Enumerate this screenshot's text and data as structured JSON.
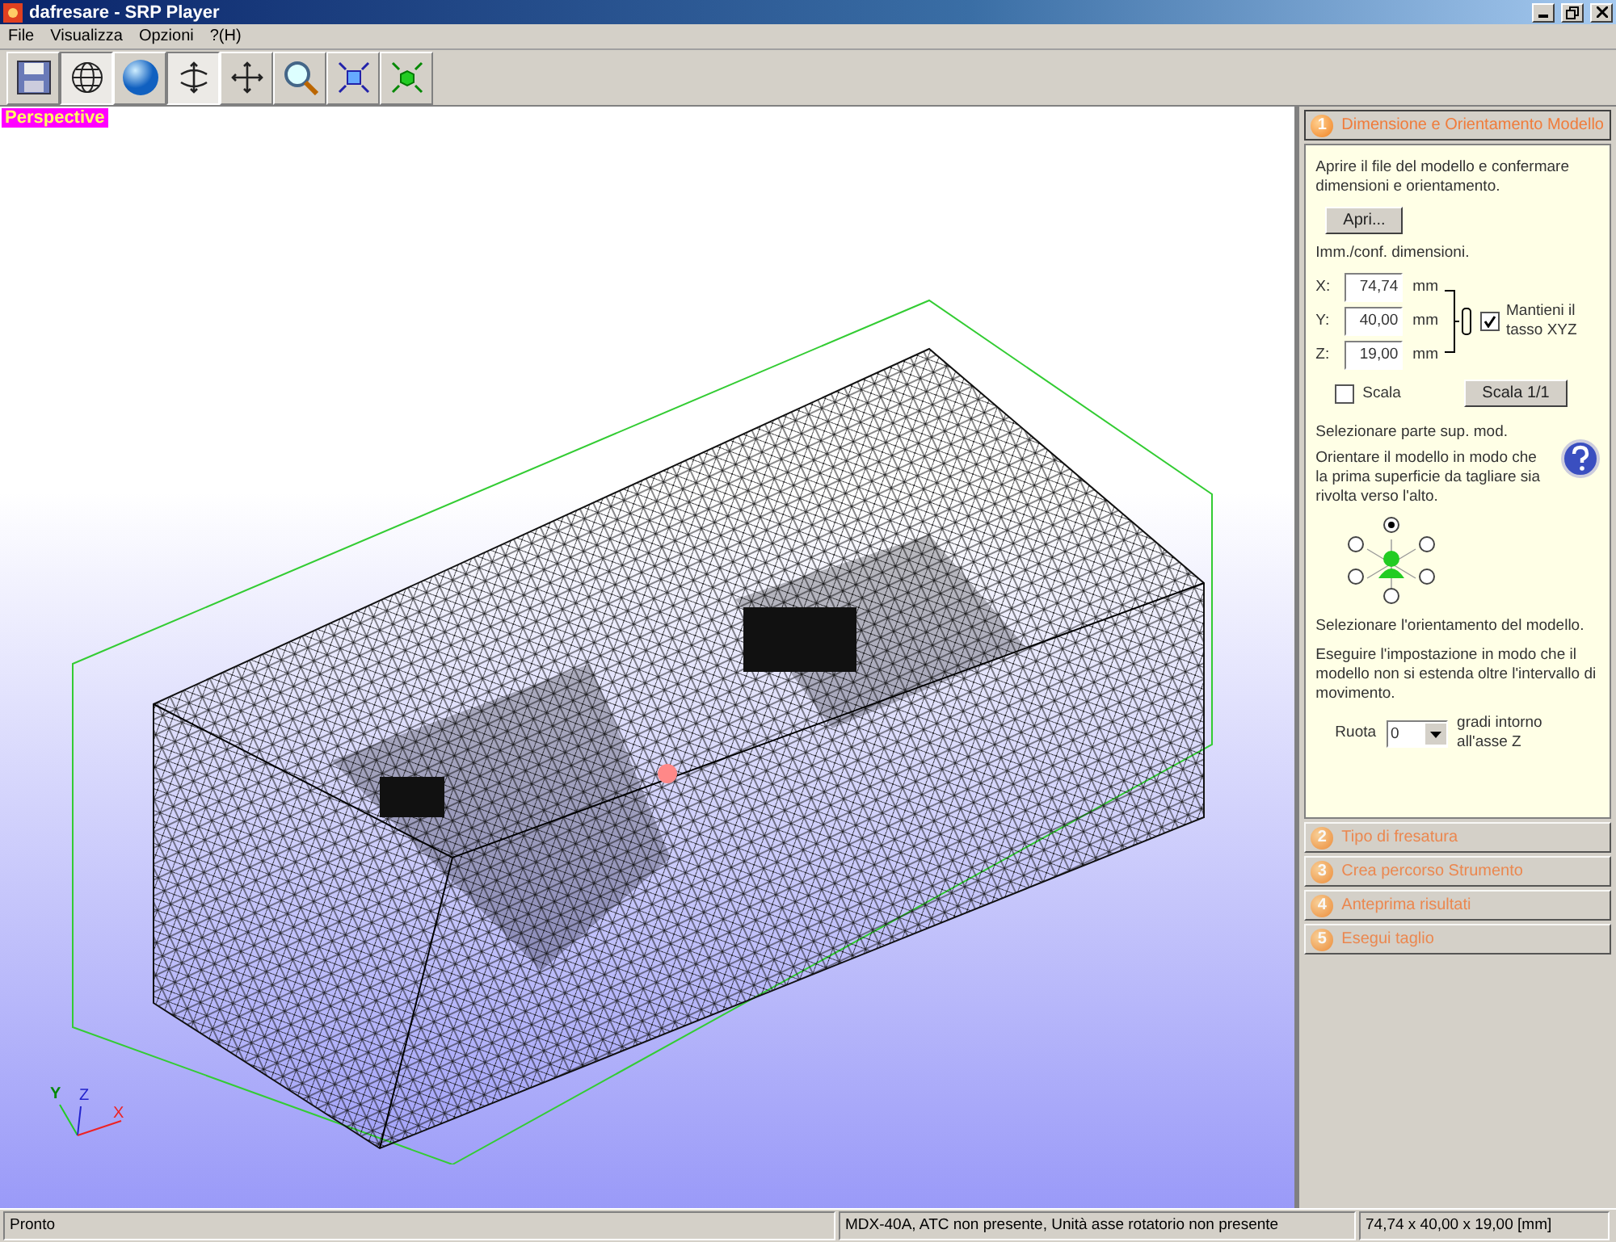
{
  "window": {
    "title": "dafresare - SRP Player"
  },
  "menu": [
    "File",
    "Visualizza",
    "Opzioni",
    "?(H)"
  ],
  "toolbar": [
    {
      "kind": "save",
      "selected": false
    },
    {
      "kind": "globe",
      "selected": true
    },
    {
      "kind": "sphere",
      "selected": false
    },
    {
      "kind": "rotate",
      "selected": true
    },
    {
      "kind": "move",
      "selected": false
    },
    {
      "kind": "zoom",
      "selected": false
    },
    {
      "kind": "fit",
      "selected": false
    },
    {
      "kind": "center",
      "selected": false
    }
  ],
  "viewport": {
    "mode_label": "Perspective",
    "axes": [
      "X",
      "Y",
      "Z"
    ]
  },
  "steps": [
    {
      "number": "1",
      "label": "Dimensione e Orientamento Modello",
      "expanded": true
    },
    {
      "number": "2",
      "label": "Tipo di fresatura",
      "expanded": false
    },
    {
      "number": "3",
      "label": "Crea percorso Strumento",
      "expanded": false
    },
    {
      "number": "4",
      "label": "Anteprima risultati",
      "expanded": false
    },
    {
      "number": "5",
      "label": "Esegui taglio",
      "expanded": false
    }
  ],
  "panel": {
    "intro": "Aprire il file del modello e confermare dimensioni e orientamento.",
    "open_button": "Apri...",
    "dims_label": "Imm./conf. dimensioni.",
    "dims": [
      {
        "axis": "X:",
        "value": "74,74",
        "unit": "mm"
      },
      {
        "axis": "Y:",
        "value": "40,00",
        "unit": "mm"
      },
      {
        "axis": "Z:",
        "value": "19,00",
        "unit": "mm"
      }
    ],
    "keep_ratio": {
      "label": "Mantieni il tasso XYZ",
      "checked": true
    },
    "scale": {
      "label": "Scala",
      "checked": false
    },
    "scale_button": "Scala 1/1",
    "surface_title": "Selezionare parte sup. mod.",
    "surface_text": "Orientare il modello in modo che la prima superficie da tagliare sia rivolta verso l'alto.",
    "orient_radios": [
      {
        "selected": true
      },
      {
        "selected": false
      },
      {
        "selected": false
      },
      {
        "selected": false
      },
      {
        "selected": false
      },
      {
        "selected": false
      }
    ],
    "orient_title": "Selezionare l'orientamento del modello.",
    "orient_text": "Eseguire l'impostazione in modo che il modello non si estenda oltre l'intervallo di movimento.",
    "rotate_label": "Ruota",
    "rotate_value": "0",
    "rotate_suffix": "gradi intorno all'asse Z"
  },
  "status_bar": [
    "Pronto",
    "MDX-40A, ATC non presente, Unità asse rotatorio non presente",
    "74,74 x  40,00 x  19,00 [mm]"
  ]
}
